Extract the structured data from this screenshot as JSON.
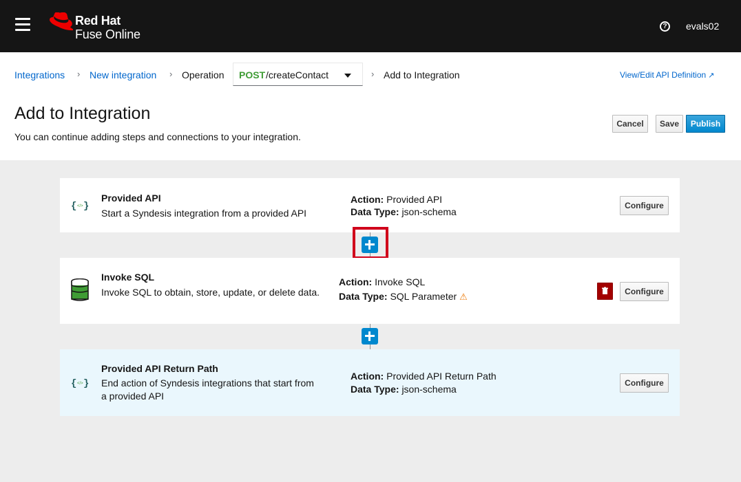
{
  "masthead": {
    "brand_line1": "Red Hat",
    "brand_line2": "Fuse Online",
    "help_icon": "question-circle-icon",
    "username": "evals02"
  },
  "breadcrumb": {
    "items": [
      {
        "label": "Integrations"
      },
      {
        "label": "New integration"
      },
      {
        "label": "Operation"
      },
      {
        "label": "Add to Integration"
      }
    ],
    "operation": {
      "method": "POST",
      "path": "/createContact"
    }
  },
  "header": {
    "api_link": "View/Edit API Definition",
    "title": "Add to Integration",
    "description": "You can continue adding steps and connections to your integration.",
    "buttons": {
      "cancel": "Cancel",
      "save": "Save",
      "publish": "Publish"
    }
  },
  "steps": [
    {
      "icon": "json-braces-icon",
      "title": "Provided API",
      "description": "Start a Syndesis integration from a provided API",
      "action_label": "Action:",
      "action": "Provided API",
      "datatype_label": "Data Type:",
      "datatype": "json-schema",
      "configure": "Configure"
    },
    {
      "icon": "database-icon",
      "title": "Invoke SQL",
      "description": "Invoke SQL to obtain, store, update, or delete data.",
      "action_label": "Action:",
      "action": "Invoke SQL",
      "datatype_label": "Data Type:",
      "datatype": "SQL Parameter",
      "warning_icon": "warning-triangle-icon",
      "configure": "Configure"
    },
    {
      "icon": "json-braces-icon",
      "title": "Provided API Return Path",
      "description": "End action of Syndesis integrations that start from a provided API",
      "action_label": "Action:",
      "action": "Provided API Return Path",
      "datatype_label": "Data Type:",
      "datatype": "json-schema",
      "configure": "Configure"
    }
  ],
  "colors": {
    "masthead": "#151515",
    "link": "#0066cc",
    "primary": "#0088ce",
    "method_post": "#3f9c35",
    "delete": "#a30000",
    "highlight": "#d0021b",
    "warning": "#ec7a08",
    "active_card": "#eaf7fd"
  }
}
